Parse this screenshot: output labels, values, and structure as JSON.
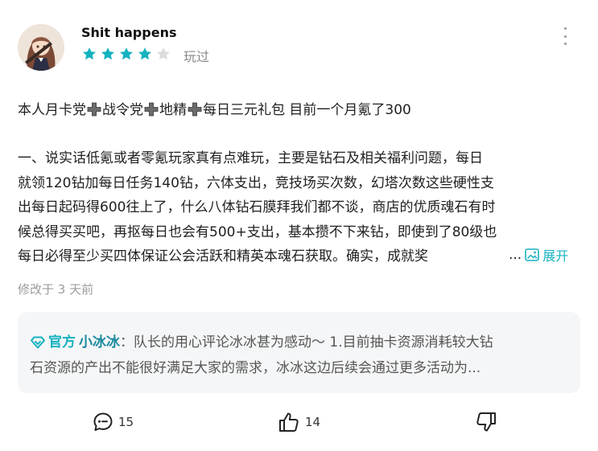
{
  "review": {
    "username": "Shit happens",
    "rating": 4,
    "rating_max": 5,
    "played_label": "玩过",
    "headline_parts": [
      "本人月卡党",
      "战令党",
      "地精",
      "每日三元礼包 目前一个月氪了300"
    ],
    "body_lines": [
      "一、说实话低氪或者零氪玩家真有点难玩，主要是钻石及相关福利问题，每日",
      "就领120钻加每日任务140钻，六体支出，竞技场买次数，幻塔次数这些硬性支",
      "出每日起码得600往上了，什么八体钻石膜拜我们都不谈，商店的优质魂石有时",
      "候总得买买吧，再抠每日也会有500+支出，基本攒不下来钻，即使到了80级也",
      "每日必得至少买四体保证公会活跃和精英本魂石获取。确实，成就奖"
    ],
    "ellipsis": "...",
    "expand_label": "展开",
    "modified": "修改于 3 天前"
  },
  "reply": {
    "official_label": "官方",
    "author": "小冰冰",
    "lines": [
      "：队长的用心评论冰冰甚为感动～ 1.目前抽卡资源消耗较大钻",
      "石资源的产出不能很好满足大家的需求，冰冰这边后续会通过更多活动为..."
    ]
  },
  "actions": {
    "comments": "15",
    "likes": "14"
  },
  "colors": {
    "accent": "#15b2c0",
    "star_empty": "#dcdcdc"
  }
}
